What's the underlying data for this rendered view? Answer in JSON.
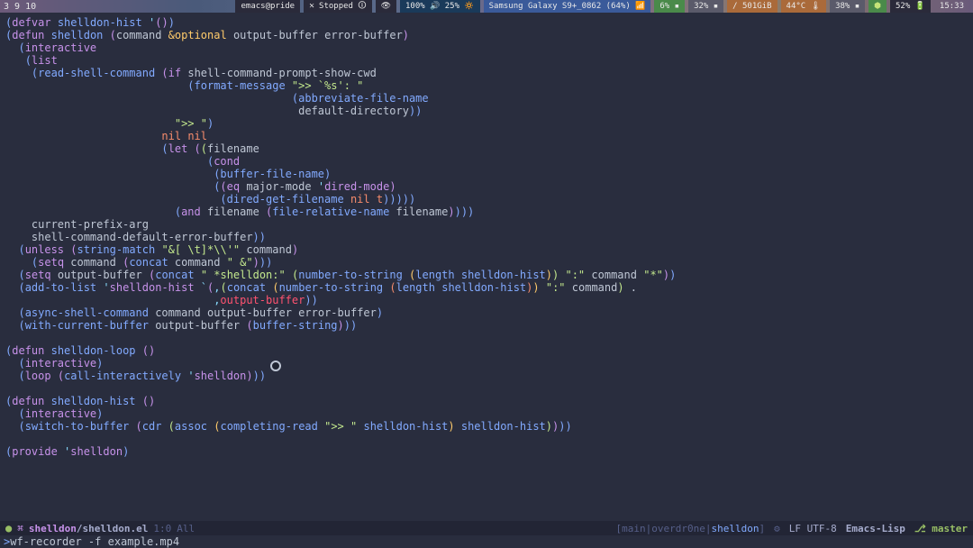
{
  "topbar": {
    "workspaces": [
      "3",
      "9",
      "10"
    ],
    "emacs_host": "emacs@pride",
    "sync": "🞫 Stopped 🛈",
    "volume": "100% 🔊 25% 🔅",
    "device": "Samsung Galaxy S9+_0862 (64%) 📶",
    "cpu": "6% ▪",
    "mem": "32% ▪",
    "disk": "/ 501GiB",
    "temp": "44°C 🌡",
    "gpu": "38% ▪",
    "bat": "52% 🔋",
    "time": "15:33"
  },
  "code": [
    "(defvar shelldon-hist '())",
    "(defun shelldon (command &optional output-buffer error-buffer)",
    "  (interactive",
    "   (list",
    "    (read-shell-command (if shell-command-prompt-show-cwd",
    "                            (format-message \">> `%s': \"",
    "                                            (abbreviate-file-name",
    "                                             default-directory))",
    "                          \">> \")",
    "                        nil nil",
    "                        (let ((filename",
    "                               (cond",
    "                                (buffer-file-name)",
    "                                ((eq major-mode 'dired-mode)",
    "                                 (dired-get-filename nil t)))))",
    "                          (and filename (file-relative-name filename))))",
    "    current-prefix-arg",
    "    shell-command-default-error-buffer))",
    "  (unless (string-match \"&[ \\t]*\\\\'\" command)",
    "    (setq command (concat command \" &\")))",
    "  (setq output-buffer (concat \" *shelldon:\" (number-to-string (length shelldon-hist)) \":\" command \"*\"))",
    "  (add-to-list 'shelldon-hist `(,(concat (number-to-string (length shelldon-hist)) \":\" command) .",
    "                                ,output-buffer))",
    "  (async-shell-command command output-buffer error-buffer)",
    "  (with-current-buffer output-buffer (buffer-string)))",
    "",
    "(defun shelldon-loop ()",
    "  (interactive)",
    "  (loop (call-interactively 'shelldon)))",
    "",
    "(defun shelldon-hist ()",
    "  (interactive)",
    "  (switch-to-buffer (cdr (assoc (completing-read \">> \" shelldon-hist) shelldon-hist))))",
    "",
    "(provide 'shelldon)"
  ],
  "modeline": {
    "project": "shelldon",
    "file": "shelldon.el",
    "pos": "1:0",
    "scroll": "All",
    "persp_raw": "[main|overdr0ne|shelldon]",
    "persp_pre": "[main|overdr0ne|",
    "persp_hl": "shelldon",
    "persp_suf": "]",
    "encoding": "LF  UTF-8",
    "mode": "Emacs-Lisp",
    "branch_glyph": "⎇",
    "branch": "master"
  },
  "minibuffer": {
    "prompt": ">",
    "text": " wf-recorder -f example.mp4"
  }
}
